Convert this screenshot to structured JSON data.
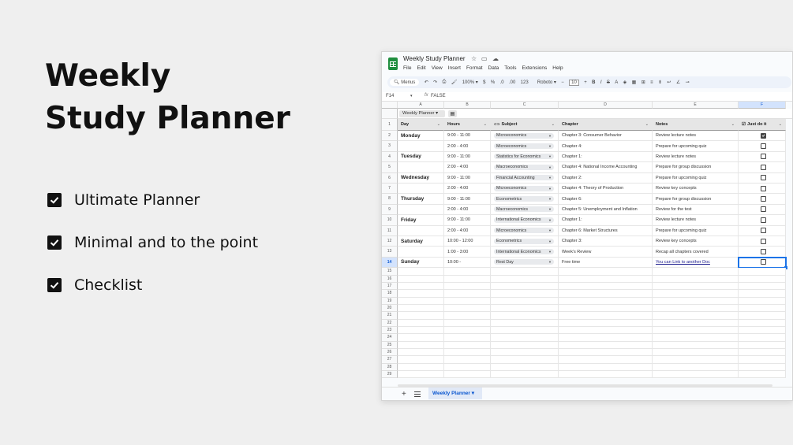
{
  "hero": {
    "line1": "Weekly",
    "line2": "Study Planner"
  },
  "features": [
    "Ultimate Planner",
    "Minimal and to the point",
    "Checklist"
  ],
  "window": {
    "title": "Weekly Study Planner",
    "menus": [
      "File",
      "Edit",
      "View",
      "Insert",
      "Format",
      "Data",
      "Tools",
      "Extensions",
      "Help"
    ],
    "toolbar": {
      "search": "Menus",
      "zoom": "100%",
      "currency": "$",
      "percent": "%",
      "dec_less": ".0",
      "dec_more": ".00",
      "number": "123",
      "font": "Roboto",
      "font_size": "10",
      "bold": "B",
      "italic": "I",
      "strike": "S",
      "text_color": "A"
    },
    "formula": {
      "cell": "F14",
      "fx": "fx",
      "value": "FALSE"
    },
    "columns": [
      "A",
      "B",
      "C",
      "D",
      "E",
      "F"
    ],
    "filter_view": "Weekly Planner",
    "headers": {
      "day": "Day",
      "hours": "Hours",
      "subject": "Subject",
      "chapter": "Chapter",
      "notes": "Notes",
      "done": "Just do it"
    },
    "rows": [
      {
        "day": "Monday",
        "hours": "9:00 - 11:00",
        "subject": "Microeconomics",
        "chapter": "Chapter 3: Consumer Behavior",
        "notes": "Review lecture notes",
        "done": true
      },
      {
        "day": "",
        "hours": "2:00 - 4:00",
        "subject": "Microeconomics",
        "chapter": "Chapter 4:",
        "notes": "Prepare for upcoming quiz",
        "done": false
      },
      {
        "day": "Tuesday",
        "hours": "9:00 - 11:00",
        "subject": "Statistics for Economics",
        "chapter": "Chapter 1:",
        "notes": "Review lecture notes",
        "done": false
      },
      {
        "day": "",
        "hours": "2:00 - 4:00",
        "subject": "Macroeconomics",
        "chapter": "Chapter 4: National Income Accounting",
        "notes": "Prepare for group discussion",
        "done": false
      },
      {
        "day": "Wednesday",
        "hours": "9:00 - 11:00",
        "subject": "Financial Accounting",
        "chapter": "Chapter 2:",
        "notes": "Prepare for upcoming quiz",
        "done": false
      },
      {
        "day": "",
        "hours": "2:00 - 4:00",
        "subject": "Microeconomics",
        "chapter": "Chapter 4: Theory of Production",
        "notes": "Review key concepts",
        "done": false
      },
      {
        "day": "Thursday",
        "hours": "9:00 - 11:00",
        "subject": "Econometrics",
        "chapter": "Chapter 6:",
        "notes": "Prepare for group discussion",
        "done": false
      },
      {
        "day": "",
        "hours": "2:00 - 4:00",
        "subject": "Macroeconomics",
        "chapter": "Chapter 5: Unemployment and Inflation",
        "notes": "Review for the test",
        "done": false
      },
      {
        "day": "Friday",
        "hours": "9:00 - 11:00",
        "subject": "International Economics",
        "chapter": "Chapter 1:",
        "notes": "Review lecture notes",
        "done": false
      },
      {
        "day": "",
        "hours": "2:00 - 4:00",
        "subject": "Microeconomics",
        "chapter": "Chapter 6: Market Structures",
        "notes": "Prepare for upcoming quiz",
        "done": false
      },
      {
        "day": "Saturday",
        "hours": "10:00 - 12:00",
        "subject": "Econometrics",
        "chapter": "Chapter 3:",
        "notes": "Review key concepts",
        "done": false
      },
      {
        "day": "",
        "hours": "1:00 - 3:00",
        "subject": "International Economics",
        "chapter": "Week's Review",
        "notes": "Recap all chapters covered",
        "done": false
      },
      {
        "day": "Sunday",
        "hours": "10:00 -",
        "subject": "Rest Day",
        "chapter": "Free time",
        "notes": "You can Link to another Doc",
        "done": false
      }
    ],
    "sheet_tab": "Weekly Planner"
  },
  "colors": {
    "accent": "#1a73e8",
    "sheets_green": "#1e8e3e",
    "tab_text": "#0b57d0"
  },
  "icons": [
    "checkbox-checked-icon",
    "star-icon",
    "folder-icon",
    "cloud-icon",
    "search-icon",
    "undo-icon",
    "redo-icon",
    "print-icon",
    "paint-format-icon",
    "chevron-down-icon",
    "add-sheet-icon",
    "sheet-list-icon"
  ]
}
